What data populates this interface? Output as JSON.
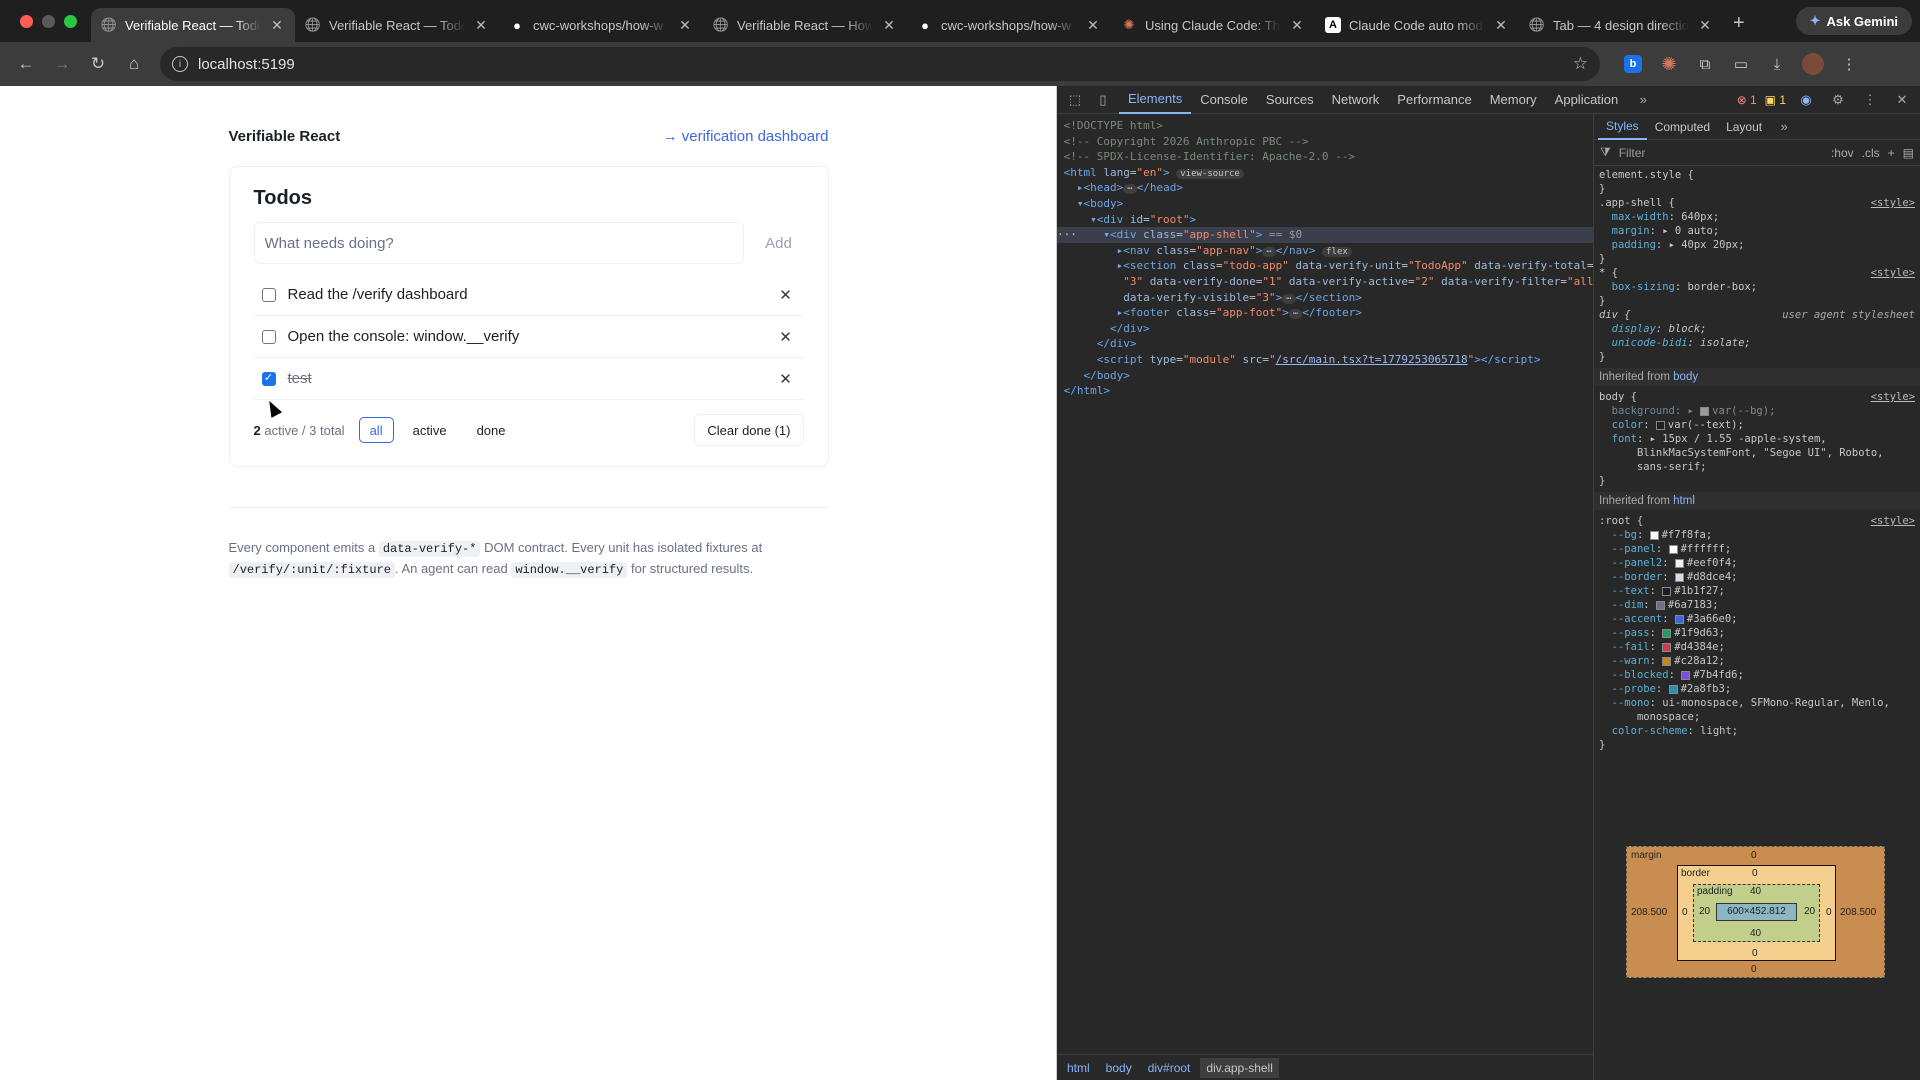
{
  "browser": {
    "tabs": [
      {
        "title": "Verifiable React — Todo",
        "icon": "globe-icon",
        "active": true
      },
      {
        "title": "Verifiable React — Todo",
        "icon": "globe-icon"
      },
      {
        "title": "cwc-workshops/how-w",
        "icon": "github-icon"
      },
      {
        "title": "Verifiable React — How",
        "icon": "globe-icon"
      },
      {
        "title": "cwc-workshops/how-w",
        "icon": "github-icon"
      },
      {
        "title": "Using Claude Code: Th",
        "icon": "claude-icon"
      },
      {
        "title": "Claude Code auto mod",
        "icon": "anthropic-icon"
      },
      {
        "title": "Tab — 4 design directio",
        "icon": "globe-icon"
      }
    ],
    "gemini_label": "Ask Gemini",
    "url": "localhost:5199"
  },
  "app": {
    "brand": "Verifiable React",
    "dashboard_link": "→ verification dashboard",
    "title": "Todos",
    "input_placeholder": "What needs doing?",
    "add_label": "Add",
    "todos": [
      {
        "text": "Read the /verify dashboard",
        "done": false
      },
      {
        "text": "Open the console: window.__verify",
        "done": false
      },
      {
        "text": "test",
        "done": true
      }
    ],
    "active_count": "2",
    "counts_suffix": "active / 3 total",
    "filters": [
      "all",
      "active",
      "done"
    ],
    "active_filter": "all",
    "clear_label": "Clear done (1)",
    "footer": {
      "t1": "Every component emits a",
      "c1": "data-verify-*",
      "t2": "DOM contract. Every unit has isolated fixtures at",
      "c2": "/verify/:unit/:fixture",
      "t3": ". An agent can read",
      "c3": "window.__verify",
      "t4": "for structured results."
    }
  },
  "devtools": {
    "tabs": [
      "Elements",
      "Console",
      "Sources",
      "Network",
      "Performance",
      "Memory",
      "Application"
    ],
    "active_tab": "Elements",
    "error_count": "1",
    "warn_count": "1",
    "styles_tabs": [
      "Styles",
      "Computed",
      "Layout"
    ],
    "filter_placeholder": "Filter",
    "filter_tools": [
      ":hov",
      ".cls"
    ],
    "crumbs": [
      "html",
      "body",
      "div#root",
      "div.app-shell"
    ],
    "dom": {
      "doctype": "<!DOCTYPE html>",
      "c1": "<!-- Copyright 2026 Anthropic PBC -->",
      "c2": "<!-- SPDX-License-Identifier: Apache-2.0 -->",
      "html_lang": "en",
      "view_source": "view-source",
      "root_id": "root",
      "shell_class": "app-shell",
      "eq0": "== $0",
      "nav_class": "app-nav",
      "flex": "flex",
      "section_class": "todo-app",
      "verify_unit": "TodoApp",
      "verify_total": "3",
      "verify_done": "1",
      "verify_active": "2",
      "verify_filter": "all",
      "verify_visible": "3",
      "footer_class": "app-foot",
      "script_src": "/src/main.tsx?t=1779253065718"
    },
    "rules": {
      "element_style": "element.style {",
      "app_shell_sel": ".app-shell {",
      "max_width": "640px;",
      "margin": "0 auto;",
      "padding": "40px 20px;",
      "star_sel": "* {",
      "box_sizing": "border-box;",
      "div_sel": "div {",
      "ua": "user agent stylesheet",
      "display": "block;",
      "unicode_bidi": "isolate;",
      "inherited_body": "body",
      "inherited_html": "html",
      "inherited_from": "Inherited from",
      "style_src": "<style>",
      "body_bg": "var(--bg);",
      "body_color": "var(--text);",
      "body_font": "15px / 1.55 -apple-system,",
      "body_font2": "BlinkMacSystemFont, \"Segoe UI\", Roboto,",
      "body_font3": "sans-serif;",
      "root_vars": [
        {
          "name": "--bg",
          "value": "#f7f8fa",
          "color": "#f7f8fa"
        },
        {
          "name": "--panel",
          "value": "#ffffff",
          "color": "#ffffff"
        },
        {
          "name": "--panel2",
          "value": "#eef0f4",
          "color": "#eef0f4"
        },
        {
          "name": "--border",
          "value": "#d8dce4",
          "color": "#d8dce4"
        },
        {
          "name": "--text",
          "value": "#1b1f27",
          "color": "#1b1f27"
        },
        {
          "name": "--dim",
          "value": "#6a7183",
          "color": "#6a7183"
        },
        {
          "name": "--accent",
          "value": "#3a66e0",
          "color": "#3a66e0"
        },
        {
          "name": "--pass",
          "value": "#1f9d63",
          "color": "#1f9d63"
        },
        {
          "name": "--fail",
          "value": "#d4384e",
          "color": "#d4384e"
        },
        {
          "name": "--warn",
          "value": "#c28a12",
          "color": "#c28a12"
        },
        {
          "name": "--blocked",
          "value": "#7b4fd6",
          "color": "#7b4fd6"
        },
        {
          "name": "--probe",
          "value": "#2a8fb3",
          "color": "#2a8fb3"
        }
      ],
      "mono": "ui-monospace, SFMono-Regular, Menlo,",
      "mono2": "monospace;",
      "color_scheme": "light;"
    },
    "box_model": {
      "margin_label": "margin",
      "border_label": "border",
      "padding_label": "padding",
      "margin_top": "0",
      "margin_bottom": "0",
      "margin_left": "208.500",
      "margin_right": "208.500",
      "border_top": "0",
      "border_bottom": "0",
      "border_left": "0",
      "border_right": "0",
      "padding_top": "40",
      "padding_bottom": "40",
      "padding_left": "20",
      "padding_right": "20",
      "content": "600×452.812"
    }
  }
}
